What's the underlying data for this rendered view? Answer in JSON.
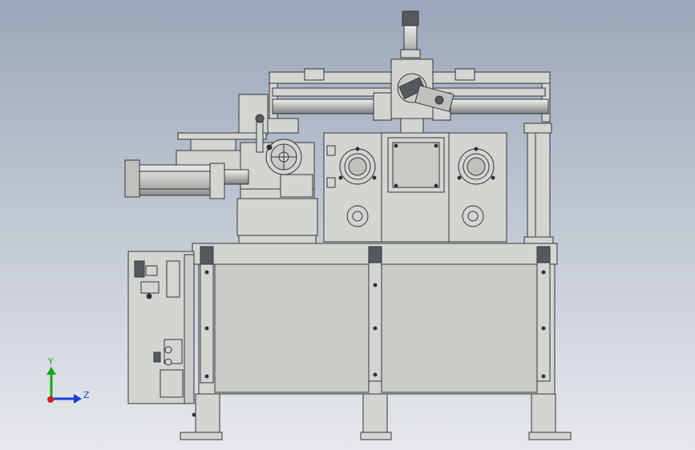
{
  "triad": {
    "y_label": "Y",
    "z_label": "Z",
    "y_color": "#17a817",
    "z_color": "#1a3fd6",
    "origin_color": "#d11b1b"
  },
  "colors": {
    "body_fill": "#d3d5d1",
    "body_stroke": "#33363a",
    "panel_fill": "#c9cbc7",
    "dark_fill": "#56595d",
    "bolt_fill": "#2b2e32"
  }
}
